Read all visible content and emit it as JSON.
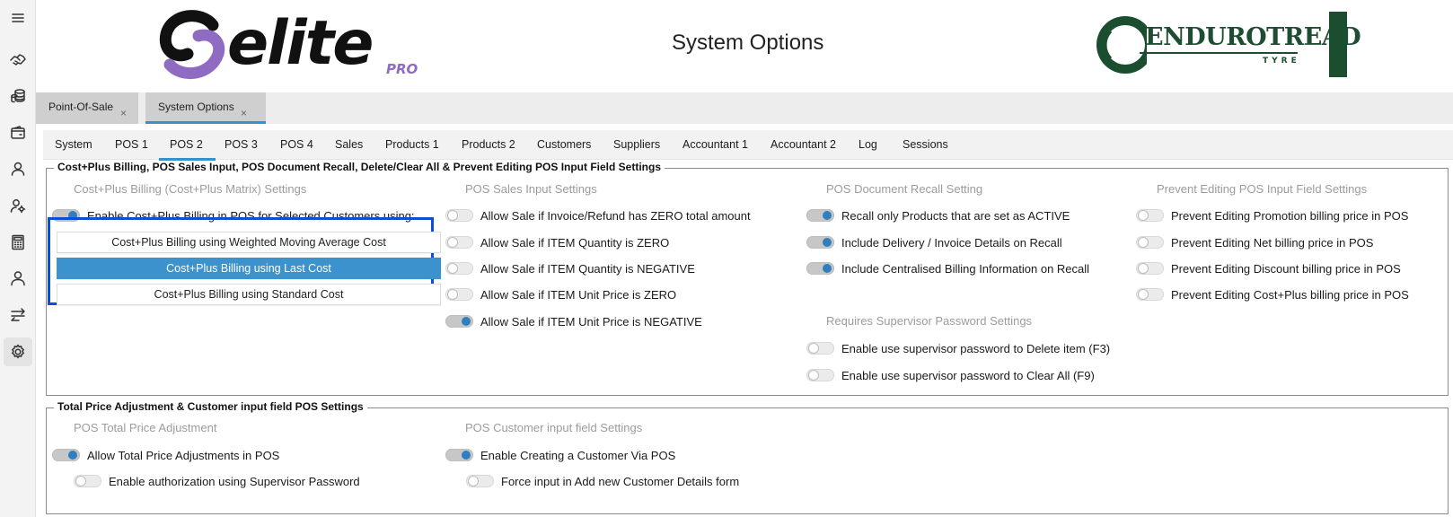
{
  "app": {
    "title": "System Options",
    "brand_left": {
      "word": "elite",
      "suffix": "PRO"
    },
    "brand_right": {
      "word": "ENDUROTREAD",
      "sub": "TYRE"
    },
    "colors": {
      "accent": "#3891c8",
      "highlight_border": "#0b4fd8",
      "brand_purple": "#8f6cc2",
      "brand_green": "#1b4d2f",
      "toggle_on": "#2f7fc0"
    }
  },
  "sidebar": {
    "icons": [
      "hamburger-icon",
      "handshake-icon",
      "coins-icon",
      "wallet-icon",
      "user-icon",
      "user-settings-icon",
      "calculator-icon",
      "person-icon",
      "transfer-icon",
      "gear-icon"
    ],
    "active": "gear-icon"
  },
  "doc_tabs": [
    {
      "label": "Point-Of-Sale",
      "close": "×",
      "active": false
    },
    {
      "label": "System Options",
      "close": "×",
      "active": true
    }
  ],
  "option_tabs": [
    "System",
    "POS 1",
    "POS 2",
    "POS 3",
    "POS 4",
    "Sales",
    "Products 1",
    "Products 2",
    "Customers",
    "Suppliers",
    "Accountant 1",
    "Accountant 2",
    "Log",
    "Sessions"
  ],
  "option_tabs_active": "POS 2",
  "group1": {
    "title": "Cost+Plus Billing, POS Sales Input, POS Document Recall, Delete/Clear All & Prevent Editing POS Input Field Settings",
    "costplus": {
      "title": "Cost+Plus Billing (Cost+Plus Matrix) Settings",
      "enable": {
        "label": "Enable Cost+Plus Billing in POS for Selected Customers using:",
        "on": true
      },
      "buttons": [
        {
          "label": "Cost+Plus Billing using Weighted Moving Average Cost",
          "selected": false
        },
        {
          "label": "Cost+Plus Billing using Last Cost",
          "selected": true
        },
        {
          "label": "Cost+Plus Billing using Standard Cost",
          "selected": false
        }
      ]
    },
    "sales_input": {
      "title": "POS Sales Input Settings",
      "items": [
        {
          "label": "Allow Sale if Invoice/Refund has ZERO total amount",
          "on": false
        },
        {
          "label": "Allow Sale if ITEM Quantity is ZERO",
          "on": false
        },
        {
          "label": "Allow Sale if ITEM Quantity is NEGATIVE",
          "on": false
        },
        {
          "label": "Allow Sale if ITEM Unit Price is ZERO",
          "on": false
        },
        {
          "label": "Allow Sale if ITEM Unit Price is NEGATIVE",
          "on": true
        }
      ]
    },
    "recall": {
      "title": "POS Document Recall Setting",
      "items": [
        {
          "label": "Recall only Products that are set as ACTIVE",
          "on": true
        },
        {
          "label": "Include Delivery / Invoice Details on Recall",
          "on": true
        },
        {
          "label": "Include Centralised Billing Information on Recall",
          "on": true
        }
      ]
    },
    "supervisor": {
      "title": "Requires Supervisor Password Settings",
      "items": [
        {
          "label": "Enable use supervisor password to Delete item (F3)",
          "on": false
        },
        {
          "label": "Enable use supervisor password to Clear All (F9)",
          "on": false
        }
      ]
    },
    "prevent_editing": {
      "title": "Prevent Editing POS Input Field Settings",
      "items": [
        {
          "label": "Prevent Editing Promotion billing price in POS",
          "on": false
        },
        {
          "label": "Prevent Editing Net billing price in POS",
          "on": false
        },
        {
          "label": "Prevent Editing Discount billing price in POS",
          "on": false
        },
        {
          "label": "Prevent Editing Cost+Plus billing price in POS",
          "on": false
        }
      ]
    }
  },
  "group2": {
    "title": "Total Price Adjustment & Customer input field POS Settings",
    "price_adjustment": {
      "title": "POS Total Price Adjustment",
      "items": [
        {
          "label": "Allow Total Price Adjustments in POS",
          "on": true
        },
        {
          "label": "Enable authorization using Supervisor Password",
          "on": false
        }
      ]
    },
    "customer_input": {
      "title": "POS Customer input field Settings",
      "items": [
        {
          "label": "Enable Creating a Customer Via POS",
          "on": true
        },
        {
          "label": "Force input in Add new Customer Details form",
          "on": false
        }
      ]
    }
  }
}
